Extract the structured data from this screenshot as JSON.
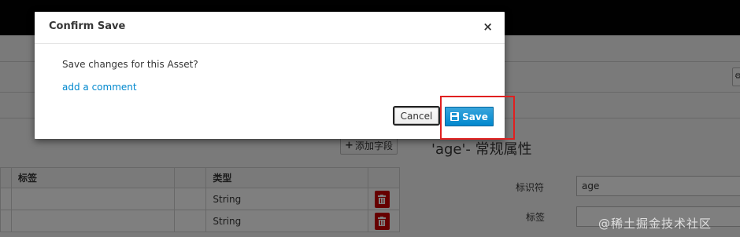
{
  "background": {
    "add_field_button": "添加字段",
    "section_title": "'age'- 常规属性",
    "table": {
      "headers": [
        "",
        "标签",
        "",
        "类型",
        ""
      ],
      "rows": [
        {
          "type": "String"
        },
        {
          "type": "String"
        }
      ]
    },
    "properties": {
      "identifier_label": "标识符",
      "identifier_value": "age",
      "label_label": "标签",
      "label_value": ""
    },
    "watermark": "@稀土掘金技术社区"
  },
  "modal": {
    "title": "Confirm Save",
    "close_glyph": "×",
    "message": "Save changes for this Asset?",
    "comment_link": "add a comment",
    "cancel_label": "Cancel",
    "save_label": "Save"
  },
  "colors": {
    "primary": "#0088ce",
    "danger": "#cc0000",
    "highlight": "#e02020"
  },
  "icons": {
    "save": "floppy-disk-icon",
    "trash": "trash-icon",
    "close": "close-icon"
  }
}
